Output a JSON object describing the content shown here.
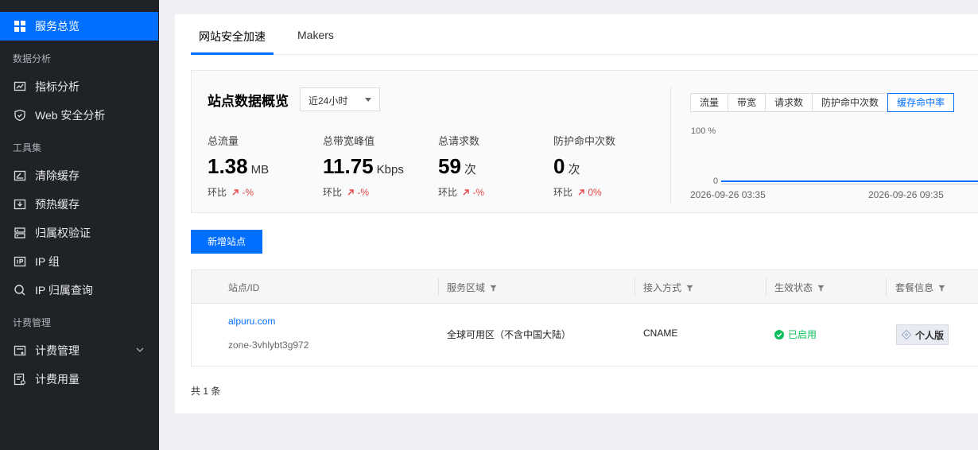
{
  "sidebar": {
    "top_item": "服务总览",
    "groups": {
      "analysis": "数据分析",
      "tools": "工具集",
      "billing": "计费管理"
    },
    "items": {
      "metrics": "指标分析",
      "web_security": "Web 安全分析",
      "purge_cache": "清除缓存",
      "prefetch_cache": "预热缓存",
      "ownership": "归属权验证",
      "ip_group": "IP 组",
      "ip_lookup": "IP 归属查询",
      "billing_manage": "计费管理",
      "billing_usage": "计费用量"
    }
  },
  "tabs": {
    "site_accel": "网站安全加速",
    "makers": "Makers"
  },
  "overview": {
    "title": "站点数据概览",
    "range": "近24小时",
    "compare_label": "环比",
    "stats": [
      {
        "label": "总流量",
        "value": "1.38",
        "unit": "MB",
        "change": "-%"
      },
      {
        "label": "总带宽峰值",
        "value": "11.75",
        "unit": "Kbps",
        "change": "-%"
      },
      {
        "label": "总请求数",
        "value": "59",
        "unit": "次",
        "change": "-%"
      },
      {
        "label": "防护命中次数",
        "value": "0",
        "unit": "次",
        "change": "0%"
      }
    ],
    "metric_tabs": [
      "流量",
      "带宽",
      "请求数",
      "防护命中次数",
      "缓存命中率"
    ],
    "active_metric": "缓存命中率",
    "chart": {
      "y_top": "100 %",
      "y_bottom": "0",
      "x_start": "2026-09-26 03:35",
      "x_mid": "2026-09-26 09:35"
    }
  },
  "add_site_button": "新增站点",
  "table": {
    "headers": {
      "site": "站点/ID",
      "region": "服务区域",
      "access": "接入方式",
      "status": "生效状态",
      "plan": "套餐信息"
    },
    "rows": [
      {
        "domain": "alpuru.com",
        "zone_id": "zone-3vhlybt3g972",
        "region": "全球可用区（不含中国大陆）",
        "access": "CNAME",
        "status": "已启用",
        "plan": "个人版"
      }
    ]
  },
  "total": "共 1 条",
  "colors": {
    "accent": "#006eff",
    "sidebar_bg": "#1f2226",
    "success": "#0abf5b",
    "danger": "#e54545"
  }
}
